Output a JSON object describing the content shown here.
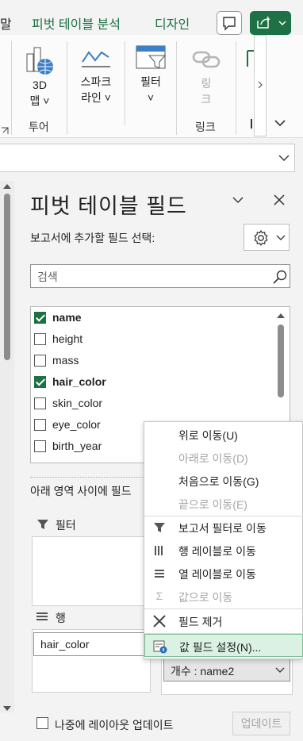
{
  "ribbon_tabs": {
    "partial": "말",
    "pivot_analyze": "피벗 테이블 분석",
    "design": "디자인"
  },
  "ribbon": {
    "map3d": {
      "line1": "3D",
      "line2": "맵 ˅"
    },
    "sparkline": {
      "line1": "스파크",
      "line2": "라인 ˅"
    },
    "filter": {
      "line1": "필터",
      "line2": "˅"
    },
    "link": {
      "line1": "링",
      "line2": "크"
    },
    "group_tour": "투어",
    "group_link": "링크"
  },
  "pane": {
    "title": "피벗 테이블 필드",
    "subtitle": "보고서에 추가할 필드 선택:",
    "search_placeholder": "검색",
    "fields": [
      {
        "label": "name",
        "checked": true
      },
      {
        "label": "height",
        "checked": false
      },
      {
        "label": "mass",
        "checked": false
      },
      {
        "label": "hair_color",
        "checked": true
      },
      {
        "label": "skin_color",
        "checked": false
      },
      {
        "label": "eye_color",
        "checked": false
      },
      {
        "label": "birth_year",
        "checked": false
      }
    ],
    "drag_message": "아래 영역 사이에 필드",
    "filter_label": "필터",
    "rows_label": "행",
    "row_item": "hair_color",
    "value_item": "개수 : name2",
    "defer_update_label": "나중에 레이아웃 업데이트",
    "update_button": "업데이트"
  },
  "context_menu": {
    "items": [
      {
        "label": "위로 이동(U)",
        "disabled": false
      },
      {
        "label": "아래로 이동(D)",
        "disabled": true
      },
      {
        "label": "처음으로 이동(G)",
        "disabled": false
      },
      {
        "label": "끝으로 이동(E)",
        "disabled": true
      },
      {
        "label": "보고서 필터로 이동",
        "disabled": false
      },
      {
        "label": "행 레이블로 이동",
        "disabled": false
      },
      {
        "label": "열 레이블로 이동",
        "disabled": false
      },
      {
        "label": "값으로 이동",
        "disabled": true
      },
      {
        "label": "필드 제거",
        "disabled": false
      },
      {
        "label": "값 필드 설정(N)...",
        "disabled": false
      }
    ]
  },
  "colors": {
    "accent": "#1e7145",
    "highlight": "#daf1e3"
  }
}
